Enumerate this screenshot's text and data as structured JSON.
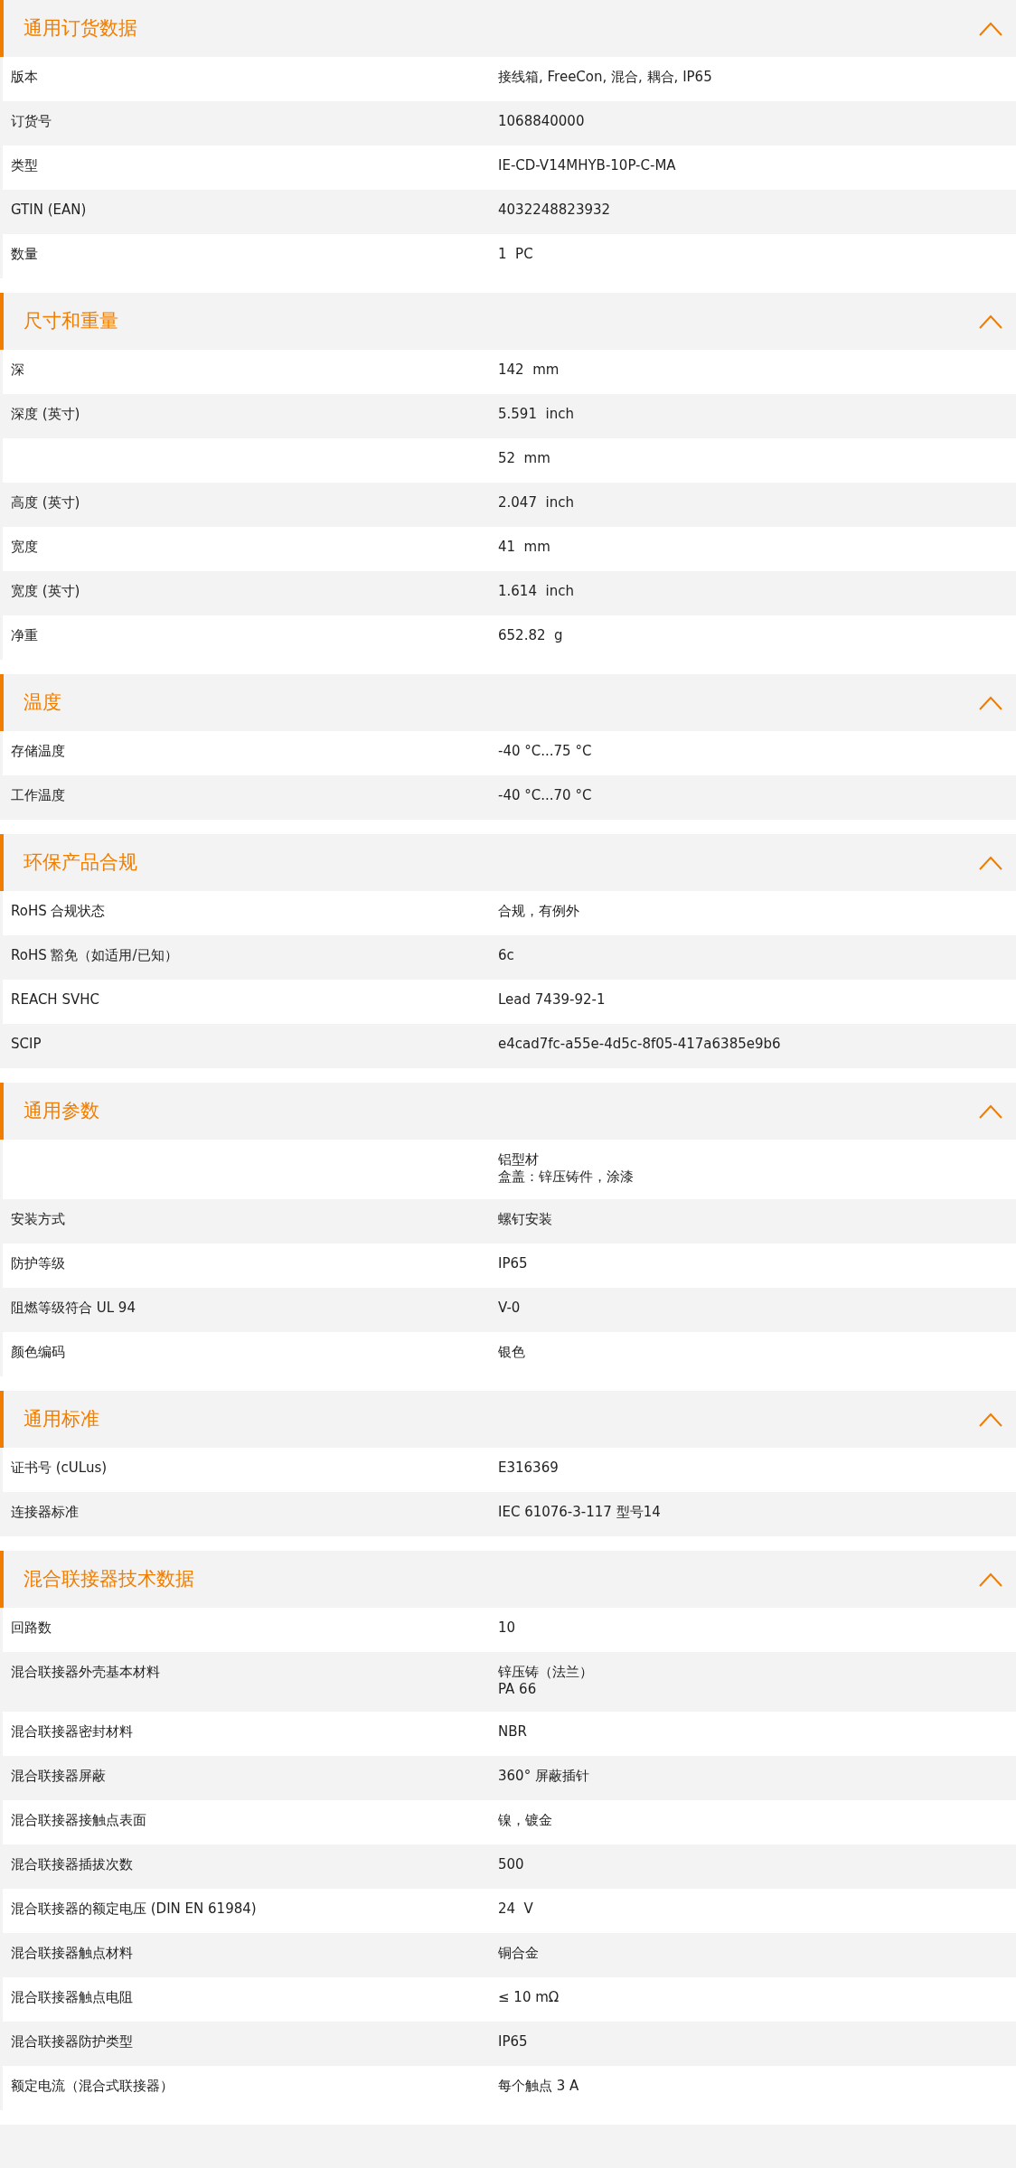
{
  "sections": [
    {
      "title": "通用订货数据",
      "expanded": true,
      "rows": [
        {
          "label": "版本",
          "value": "接线箱, FreeCon, 混合, 耦合, IP65"
        },
        {
          "label": "订货号",
          "value": "1068840000"
        },
        {
          "label": "类型",
          "value": "IE-CD-V14MHYB-10P-C-MA"
        },
        {
          "label": "GTIN (EAN)",
          "value": "4032248823932"
        },
        {
          "label": "数量",
          "value": "1  PC"
        }
      ]
    },
    {
      "title": "尺寸和重量",
      "expanded": true,
      "rows": [
        {
          "label": "深",
          "value": "142  mm"
        },
        {
          "label": "深度 (英寸)",
          "value": "5.591  inch"
        },
        {
          "value": "52  mm"
        },
        {
          "label": "高度 (英寸)",
          "value": "2.047  inch"
        },
        {
          "label": "宽度",
          "value": "41  mm"
        },
        {
          "label": "宽度 (英寸)",
          "value": "1.614  inch"
        },
        {
          "label": "净重",
          "value": "652.82  g"
        }
      ]
    },
    {
      "title": "温度",
      "expanded": true,
      "rows": [
        {
          "label": "存储温度",
          "value": "-40 °C...75 °C"
        },
        {
          "label": "工作温度",
          "value": "-40 °C...70 °C"
        }
      ]
    },
    {
      "title": "环保产品合规",
      "expanded": true,
      "rows": [
        {
          "label": "RoHS 合规状态",
          "value": "合规，有例外"
        },
        {
          "label": "RoHS 豁免（如适用/已知）",
          "value": "6c"
        },
        {
          "label": "REACH SVHC",
          "value": "Lead 7439-92-1"
        },
        {
          "label": "SCIP",
          "value": "e4cad7fc-a55e-4d5c-8f05-417a6385e9b6"
        }
      ]
    },
    {
      "title": "通用参数",
      "expanded": true,
      "rows": [
        {
          "lines": [
            "铝型材",
            "盒盖：锌压铸件，涂漆"
          ]
        },
        {
          "label": "安装方式",
          "value": "螺钉安装"
        },
        {
          "label": "防护等级",
          "value": "IP65"
        },
        {
          "label": "阻燃等级符合 UL 94",
          "value": "V-0"
        },
        {
          "label": "颜色编码",
          "value": "银色"
        }
      ]
    },
    {
      "title": "通用标准",
      "expanded": true,
      "rows": [
        {
          "label": "证书号 (cULus)",
          "value": "E316369"
        },
        {
          "label": "连接器标准",
          "value": "IEC 61076-3-117 型号14"
        }
      ]
    },
    {
      "title": "混合联接器技术数据",
      "expanded": true,
      "rows": [
        {
          "label": "回路数",
          "value": "10"
        },
        {
          "label": "混合联接器外壳基本材料",
          "lines": [
            "锌压铸（法兰）",
            "PA 66"
          ]
        },
        {
          "label": "混合联接器密封材料",
          "value": "NBR"
        },
        {
          "label": "混合联接器屏蔽",
          "value": "360° 屏蔽插针"
        },
        {
          "label": "混合联接器接触点表面",
          "value": "镍，镀金"
        },
        {
          "label": "混合联接器插拔次数",
          "value": "500"
        },
        {
          "label": "混合联接器的额定电压 (DIN EN 61984)",
          "value": "24  V"
        },
        {
          "label": "混合联接器触点材料",
          "value": "铜合金"
        },
        {
          "label": "混合联接器触点电阻",
          "value": "≤ 10 mΩ"
        },
        {
          "label": "混合联接器防护类型",
          "value": "IP65"
        },
        {
          "label": "额定电流（混合式联接器）",
          "value": "每个触点 3 A"
        }
      ]
    }
  ]
}
